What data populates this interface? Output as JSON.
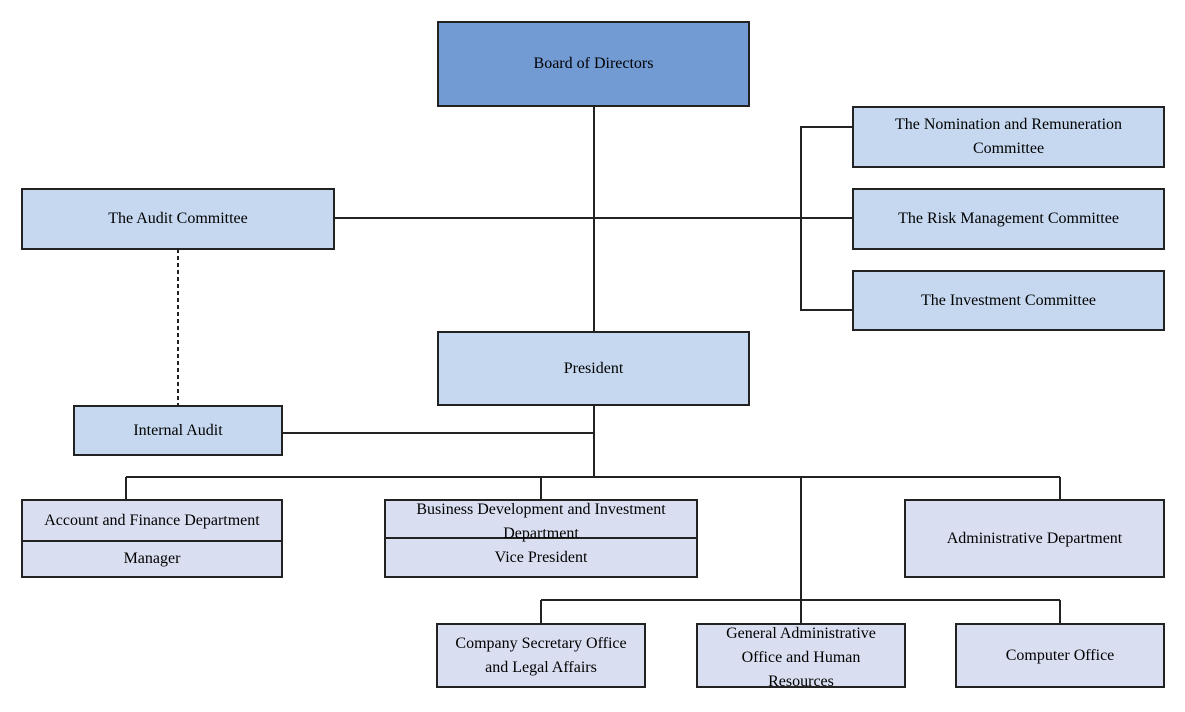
{
  "colors": {
    "board": "#729bd4",
    "committee": "#c5d8ef",
    "department": "#d9def0",
    "line": "#222222"
  },
  "nodes": {
    "board": "Board of Directors",
    "nomination": "The Nomination and Remuneration Committee",
    "risk": "The Risk Management Committee",
    "investment": "The Investment Committee",
    "audit_committee": "The Audit Committee",
    "president": "President",
    "internal_audit": "Internal Audit",
    "account_finance": {
      "title": "Account and Finance Department",
      "head": "Manager"
    },
    "business_dev": {
      "title": "Business Development and Investment Department",
      "head": "Vice President"
    },
    "administrative": "Administrative Department",
    "company_secretary": "Company Secretary Office and Legal Affairs",
    "general_admin": "General Administrative Office and Human Resources",
    "computer_office": "Computer Office"
  }
}
